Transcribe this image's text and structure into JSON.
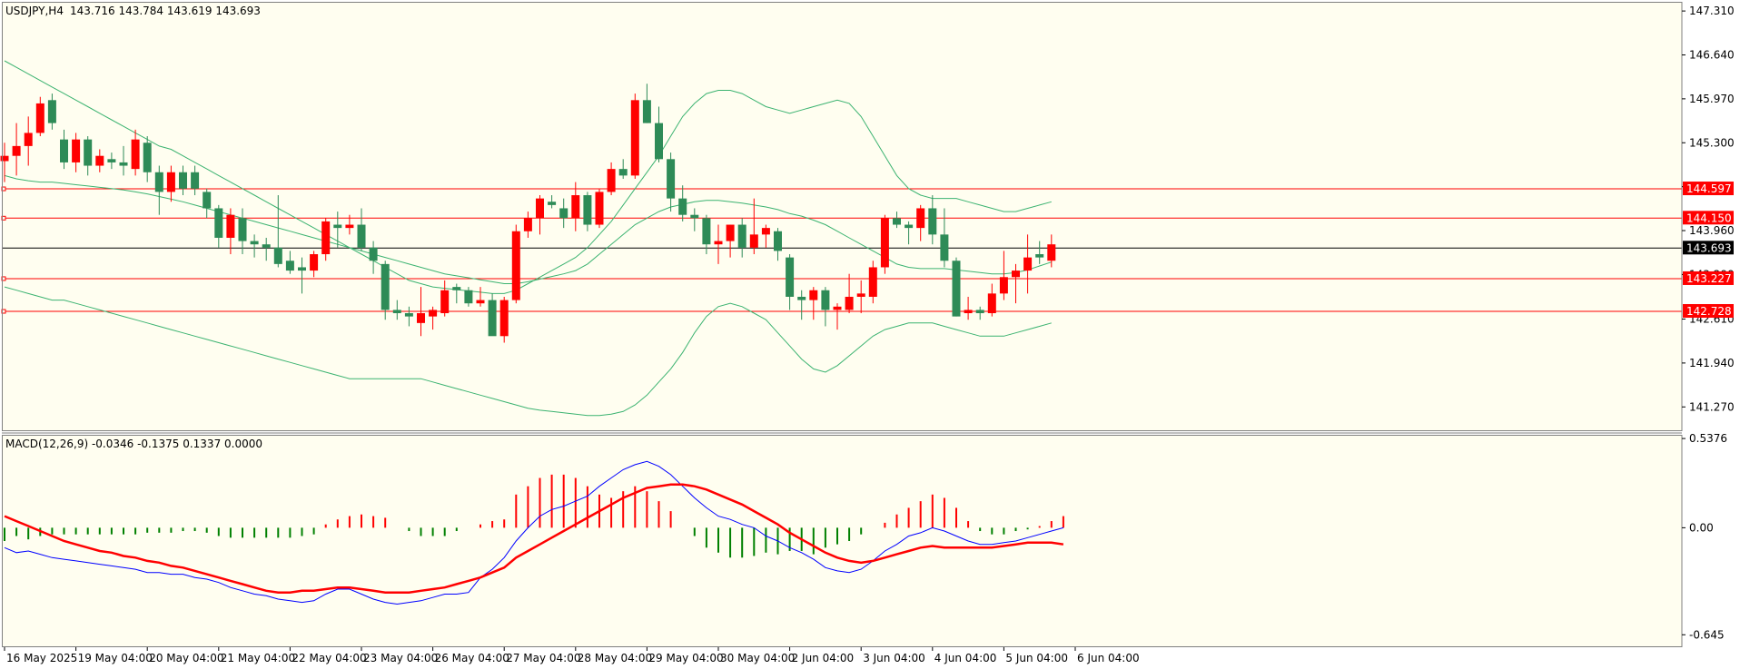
{
  "chart_header": {
    "symbol": "USDJPY,H4",
    "ohlc": "143.716 143.784 143.619 143.693"
  },
  "macd_header": "MACD(12,26,9) -0.0346 -0.1375 0.1337 0.0000",
  "colors": {
    "background": "#fffef0",
    "bull_candle": "#ff0000",
    "bear_candle": "#2e8b57",
    "bands": "#3cb371",
    "level_lines": "#ff0000",
    "price_line": "#000000",
    "macd_main": "#0000ff",
    "macd_signal": "#ff0000",
    "hist_positive": "#ff0000",
    "hist_negative": "#008000",
    "frame": "#808080"
  },
  "chart_data": [
    {
      "type": "candlestick",
      "ylim": [
        140.9,
        147.45
      ],
      "grid": false,
      "legend": "none",
      "price_axis_ticks": [
        "147.310",
        "146.640",
        "145.970",
        "145.300",
        "144.630",
        "143.960",
        "143.290",
        "142.610",
        "141.940",
        "141.270"
      ],
      "time_labels": [
        "16 May 2025",
        "19 May 04:00",
        "20 May 04:00",
        "21 May 04:00",
        "22 May 04:00",
        "23 May 04:00",
        "26 May 04:00",
        "27 May 04:00",
        "28 May 04:00",
        "29 May 04:00",
        "30 May 04:00",
        "2 Jun 04:00",
        "3 Jun 04:00",
        "4 Jun 04:00",
        "5 Jun 04:00",
        "6 Jun 04:00"
      ],
      "time_label_bar_index": [
        0,
        6,
        12,
        18,
        24,
        30,
        36,
        42,
        48,
        54,
        60,
        66,
        72,
        78,
        84,
        90
      ],
      "horizontal_levels": [
        {
          "value": 144.597,
          "label": "144.597"
        },
        {
          "value": 144.15,
          "label": "144.150"
        },
        {
          "value": 143.227,
          "label": "143.227"
        },
        {
          "value": 142.728,
          "label": "142.728"
        }
      ],
      "current_price": {
        "value": 143.693,
        "label": "143.693"
      },
      "candles": [
        [
          145.02,
          145.3,
          144.7,
          145.1
        ],
        [
          145.1,
          145.6,
          144.8,
          145.25
        ],
        [
          145.25,
          145.7,
          144.95,
          145.45
        ],
        [
          145.45,
          146.0,
          145.4,
          145.9
        ],
        [
          145.95,
          146.05,
          145.5,
          145.6
        ],
        [
          145.35,
          145.5,
          144.9,
          145.0
        ],
        [
          145.0,
          145.45,
          144.85,
          145.35
        ],
        [
          145.35,
          145.4,
          144.8,
          144.95
        ],
        [
          144.95,
          145.2,
          144.85,
          145.1
        ],
        [
          145.05,
          145.15,
          144.9,
          145.0
        ],
        [
          145.0,
          145.25,
          144.8,
          144.95
        ],
        [
          144.9,
          145.5,
          144.8,
          145.35
        ],
        [
          145.3,
          145.4,
          144.7,
          144.85
        ],
        [
          144.85,
          144.95,
          144.2,
          144.55
        ],
        [
          144.55,
          144.95,
          144.4,
          144.85
        ],
        [
          144.85,
          144.95,
          144.5,
          144.6
        ],
        [
          144.85,
          144.95,
          144.5,
          144.6
        ],
        [
          144.55,
          144.6,
          144.15,
          144.3
        ],
        [
          144.3,
          144.35,
          143.7,
          143.85
        ],
        [
          143.85,
          144.3,
          143.6,
          144.2
        ],
        [
          144.15,
          144.3,
          143.6,
          143.8
        ],
        [
          143.8,
          143.9,
          143.55,
          143.75
        ],
        [
          143.75,
          143.85,
          143.5,
          143.7
        ],
        [
          143.7,
          144.5,
          143.4,
          143.45
        ],
        [
          143.5,
          143.65,
          143.3,
          143.35
        ],
        [
          143.4,
          143.55,
          143.0,
          143.35
        ],
        [
          143.35,
          143.65,
          143.25,
          143.6
        ],
        [
          143.6,
          144.15,
          143.5,
          144.1
        ],
        [
          144.05,
          144.25,
          143.7,
          144.0
        ],
        [
          144.0,
          144.2,
          143.9,
          144.05
        ],
        [
          144.05,
          144.3,
          143.65,
          143.7
        ],
        [
          143.7,
          143.8,
          143.3,
          143.5
        ],
        [
          143.45,
          143.5,
          142.6,
          142.75
        ],
        [
          142.75,
          142.9,
          142.6,
          142.7
        ],
        [
          142.7,
          142.8,
          142.5,
          142.65
        ],
        [
          142.55,
          143.1,
          142.35,
          142.7
        ],
        [
          142.65,
          142.8,
          142.45,
          142.75
        ],
        [
          142.7,
          143.2,
          142.65,
          143.05
        ],
        [
          143.1,
          143.15,
          142.85,
          143.05
        ],
        [
          143.05,
          143.1,
          142.8,
          142.85
        ],
        [
          142.85,
          143.1,
          142.8,
          142.9
        ],
        [
          142.9,
          143.0,
          142.45,
          142.35
        ],
        [
          142.35,
          142.95,
          142.25,
          142.9
        ],
        [
          142.9,
          144.05,
          142.85,
          143.95
        ],
        [
          143.95,
          144.25,
          143.85,
          144.15
        ],
        [
          144.15,
          144.5,
          143.9,
          144.45
        ],
        [
          144.4,
          144.5,
          144.3,
          144.35
        ],
        [
          144.3,
          144.45,
          144.0,
          144.15
        ],
        [
          144.15,
          144.7,
          143.95,
          144.5
        ],
        [
          144.5,
          144.55,
          143.95,
          144.05
        ],
        [
          144.05,
          144.6,
          144.0,
          144.55
        ],
        [
          144.55,
          145.0,
          144.5,
          144.9
        ],
        [
          144.9,
          145.05,
          144.75,
          144.8
        ],
        [
          144.8,
          146.05,
          144.75,
          145.95
        ],
        [
          145.95,
          146.2,
          145.6,
          145.6
        ],
        [
          145.6,
          145.85,
          145.0,
          145.05
        ],
        [
          145.05,
          145.15,
          144.25,
          144.45
        ],
        [
          144.45,
          144.65,
          144.1,
          144.2
        ],
        [
          144.2,
          144.3,
          143.95,
          144.15
        ],
        [
          144.15,
          144.2,
          143.6,
          143.75
        ],
        [
          143.75,
          144.05,
          143.45,
          143.8
        ],
        [
          143.8,
          144.05,
          143.55,
          144.05
        ],
        [
          144.05,
          144.15,
          143.55,
          143.7
        ],
        [
          143.7,
          144.45,
          143.6,
          143.9
        ],
        [
          143.9,
          144.05,
          143.7,
          144.0
        ],
        [
          143.95,
          144.0,
          143.5,
          143.65
        ],
        [
          143.55,
          143.6,
          142.75,
          142.95
        ],
        [
          142.95,
          143.05,
          142.6,
          142.9
        ],
        [
          142.9,
          143.1,
          142.6,
          143.05
        ],
        [
          143.05,
          143.1,
          142.5,
          142.75
        ],
        [
          142.75,
          142.85,
          142.45,
          142.8
        ],
        [
          142.75,
          143.3,
          142.7,
          142.95
        ],
        [
          142.95,
          143.2,
          142.7,
          143.0
        ],
        [
          142.95,
          143.5,
          142.85,
          143.4
        ],
        [
          143.4,
          144.2,
          143.3,
          144.15
        ],
        [
          144.15,
          144.25,
          144.0,
          144.05
        ],
        [
          144.05,
          144.1,
          143.75,
          144.0
        ],
        [
          144.0,
          144.35,
          143.8,
          144.3
        ],
        [
          144.3,
          144.5,
          143.75,
          143.9
        ],
        [
          143.9,
          144.3,
          143.4,
          143.5
        ],
        [
          143.5,
          143.55,
          142.65,
          142.65
        ],
        [
          142.7,
          142.95,
          142.6,
          142.75
        ],
        [
          142.75,
          142.8,
          142.6,
          142.7
        ],
        [
          142.7,
          143.15,
          142.65,
          143.0
        ],
        [
          143.0,
          143.65,
          142.9,
          143.25
        ],
        [
          143.25,
          143.45,
          142.85,
          143.35
        ],
        [
          143.35,
          143.9,
          143.0,
          143.55
        ],
        [
          143.6,
          143.8,
          143.45,
          143.55
        ],
        [
          143.5,
          143.9,
          143.4,
          143.75
        ]
      ],
      "bands": {
        "upper": [
          146.55,
          146.45,
          146.35,
          146.25,
          146.15,
          146.05,
          145.95,
          145.85,
          145.75,
          145.65,
          145.55,
          145.45,
          145.35,
          145.25,
          145.2,
          145.1,
          145.0,
          144.9,
          144.8,
          144.7,
          144.6,
          144.5,
          144.4,
          144.3,
          144.2,
          144.1,
          144.0,
          143.9,
          143.8,
          143.7,
          143.6,
          143.5,
          143.4,
          143.3,
          143.2,
          143.15,
          143.1,
          143.08,
          143.06,
          143.04,
          143.02,
          143.0,
          143.0,
          143.05,
          143.15,
          143.25,
          143.35,
          143.45,
          143.55,
          143.7,
          143.9,
          144.1,
          144.35,
          144.6,
          144.85,
          145.1,
          145.4,
          145.7,
          145.9,
          146.05,
          146.1,
          146.1,
          146.05,
          145.95,
          145.85,
          145.8,
          145.75,
          145.8,
          145.85,
          145.9,
          145.95,
          145.9,
          145.7,
          145.4,
          145.1,
          144.8,
          144.6,
          144.5,
          144.45,
          144.45,
          144.45,
          144.4,
          144.35,
          144.3,
          144.25,
          144.25,
          144.3,
          144.35,
          144.4
        ],
        "middle": [
          144.8,
          144.75,
          144.72,
          144.7,
          144.7,
          144.68,
          144.66,
          144.64,
          144.62,
          144.6,
          144.58,
          144.55,
          144.52,
          144.48,
          144.44,
          144.4,
          144.35,
          144.3,
          144.25,
          144.2,
          144.15,
          144.1,
          144.05,
          144.0,
          143.95,
          143.9,
          143.85,
          143.8,
          143.75,
          143.7,
          143.65,
          143.6,
          143.55,
          143.5,
          143.45,
          143.4,
          143.35,
          143.3,
          143.27,
          143.24,
          143.21,
          143.18,
          143.15,
          143.15,
          143.18,
          143.22,
          143.26,
          143.3,
          143.35,
          143.45,
          143.6,
          143.75,
          143.9,
          144.05,
          144.15,
          144.25,
          144.32,
          144.36,
          144.4,
          144.42,
          144.42,
          144.4,
          144.38,
          144.35,
          144.32,
          144.28,
          144.22,
          144.18,
          144.12,
          144.05,
          143.95,
          143.85,
          143.75,
          143.65,
          143.55,
          143.45,
          143.4,
          143.38,
          143.38,
          143.38,
          143.36,
          143.34,
          143.32,
          143.3,
          143.3,
          143.32,
          143.36,
          143.42,
          143.48
        ],
        "lower": [
          143.1,
          143.05,
          143.0,
          142.95,
          142.9,
          142.9,
          142.85,
          142.8,
          142.75,
          142.7,
          142.65,
          142.6,
          142.55,
          142.5,
          142.45,
          142.4,
          142.35,
          142.3,
          142.25,
          142.2,
          142.15,
          142.1,
          142.05,
          142.0,
          141.95,
          141.9,
          141.85,
          141.8,
          141.75,
          141.7,
          141.7,
          141.7,
          141.7,
          141.7,
          141.7,
          141.7,
          141.65,
          141.6,
          141.55,
          141.5,
          141.45,
          141.4,
          141.35,
          141.3,
          141.25,
          141.22,
          141.2,
          141.18,
          141.16,
          141.14,
          141.14,
          141.16,
          141.2,
          141.3,
          141.45,
          141.65,
          141.85,
          142.1,
          142.4,
          142.65,
          142.8,
          142.85,
          142.8,
          142.7,
          142.6,
          142.4,
          142.2,
          142.0,
          141.85,
          141.8,
          141.9,
          142.05,
          142.2,
          142.35,
          142.45,
          142.5,
          142.55,
          142.55,
          142.55,
          142.5,
          142.45,
          142.4,
          142.35,
          142.35,
          142.35,
          142.4,
          142.45,
          142.5,
          142.55
        ]
      }
    },
    {
      "type": "line",
      "title": "MACD(12,26,9)",
      "ylim": [
        -0.72,
        0.56
      ],
      "axis_ticks": [
        "0.5376",
        "0.00",
        "-0.645"
      ],
      "axis_tick_values": [
        0.5376,
        0.0,
        -0.645
      ],
      "histogram": [
        -0.08,
        -0.05,
        -0.07,
        -0.05,
        -0.04,
        -0.04,
        -0.04,
        -0.04,
        -0.04,
        -0.04,
        -0.04,
        -0.04,
        -0.03,
        -0.03,
        -0.03,
        -0.02,
        -0.02,
        -0.03,
        -0.05,
        -0.06,
        -0.06,
        -0.06,
        -0.06,
        -0.06,
        -0.06,
        -0.05,
        -0.04,
        0.02,
        0.05,
        0.07,
        0.08,
        0.07,
        0.06,
        0.0,
        -0.02,
        -0.05,
        -0.05,
        -0.05,
        -0.02,
        0.0,
        0.02,
        0.04,
        0.05,
        0.2,
        0.25,
        0.3,
        0.32,
        0.32,
        0.3,
        0.25,
        0.2,
        0.18,
        0.22,
        0.25,
        0.22,
        0.16,
        0.1,
        0.0,
        -0.05,
        -0.12,
        -0.15,
        -0.18,
        -0.18,
        -0.17,
        -0.15,
        -0.16,
        -0.14,
        -0.14,
        -0.16,
        -0.12,
        -0.1,
        -0.08,
        -0.04,
        0.0,
        0.03,
        0.08,
        0.12,
        0.16,
        0.2,
        0.18,
        0.12,
        0.04,
        -0.02,
        -0.04,
        -0.04,
        -0.02,
        -0.01,
        0.01,
        0.04,
        0.07
      ],
      "series": [
        {
          "values": [
            -0.12,
            -0.15,
            -0.14,
            -0.16,
            -0.18,
            -0.19,
            -0.2,
            -0.21,
            -0.22,
            -0.23,
            -0.24,
            -0.25,
            -0.27,
            -0.27,
            -0.28,
            -0.28,
            -0.3,
            -0.31,
            -0.33,
            -0.36,
            -0.38,
            -0.4,
            -0.41,
            -0.43,
            -0.44,
            -0.45,
            -0.44,
            -0.4,
            -0.37,
            -0.37,
            -0.4,
            -0.43,
            -0.45,
            -0.46,
            -0.45,
            -0.44,
            -0.42,
            -0.4,
            -0.4,
            -0.39,
            -0.3,
            -0.25,
            -0.18,
            -0.08,
            0.0,
            0.07,
            0.11,
            0.13,
            0.16,
            0.19,
            0.25,
            0.3,
            0.35,
            0.38,
            0.4,
            0.37,
            0.32,
            0.25,
            0.18,
            0.12,
            0.07,
            0.05,
            0.02,
            0.0,
            -0.05,
            -0.08,
            -0.12,
            -0.15,
            -0.19,
            -0.24,
            -0.26,
            -0.27,
            -0.25,
            -0.2,
            -0.14,
            -0.1,
            -0.05,
            -0.03,
            0.0,
            -0.02,
            -0.05,
            -0.08,
            -0.1,
            -0.1,
            -0.09,
            -0.08,
            -0.06,
            -0.04,
            -0.02,
            0.0
          ]
        },
        {
          "values": [
            0.07,
            0.04,
            0.01,
            -0.02,
            -0.05,
            -0.08,
            -0.1,
            -0.12,
            -0.14,
            -0.15,
            -0.17,
            -0.18,
            -0.2,
            -0.21,
            -0.23,
            -0.24,
            -0.26,
            -0.28,
            -0.3,
            -0.32,
            -0.34,
            -0.36,
            -0.38,
            -0.39,
            -0.39,
            -0.38,
            -0.38,
            -0.37,
            -0.36,
            -0.36,
            -0.37,
            -0.38,
            -0.39,
            -0.39,
            -0.39,
            -0.38,
            -0.37,
            -0.36,
            -0.34,
            -0.32,
            -0.3,
            -0.27,
            -0.24,
            -0.18,
            -0.14,
            -0.1,
            -0.06,
            -0.02,
            0.02,
            0.06,
            0.1,
            0.14,
            0.18,
            0.21,
            0.24,
            0.25,
            0.26,
            0.26,
            0.25,
            0.23,
            0.2,
            0.17,
            0.14,
            0.1,
            0.06,
            0.02,
            -0.03,
            -0.07,
            -0.11,
            -0.15,
            -0.18,
            -0.2,
            -0.21,
            -0.2,
            -0.18,
            -0.16,
            -0.14,
            -0.12,
            -0.11,
            -0.12,
            -0.12,
            -0.12,
            -0.12,
            -0.12,
            -0.11,
            -0.1,
            -0.09,
            -0.09,
            -0.09,
            -0.1
          ]
        }
      ]
    }
  ]
}
